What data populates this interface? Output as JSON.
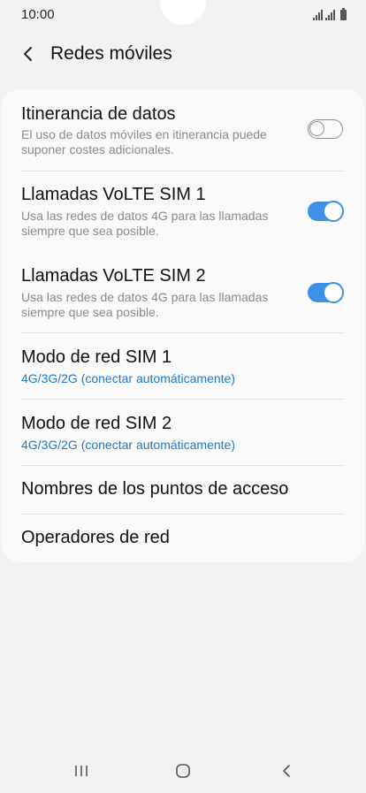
{
  "status_bar": {
    "time": "10:00",
    "icons": [
      "signal-sim1-icon",
      "signal-sim2-icon",
      "battery-icon"
    ]
  },
  "header": {
    "back_icon": "chevron-left-icon",
    "title": "Redes móviles"
  },
  "settings": {
    "data_roaming": {
      "title": "Itinerancia de datos",
      "description": "El uso de datos móviles en itinerancia puede suponer costes adicionales.",
      "enabled": false
    },
    "volte_sim1": {
      "title": "Llamadas VoLTE SIM 1",
      "description": "Usa las redes de datos 4G para las llamadas siempre que sea posible.",
      "enabled": true
    },
    "volte_sim2": {
      "title": "Llamadas VoLTE SIM 2",
      "description": "Usa las redes de datos 4G para las llamadas siempre que sea posible.",
      "enabled": true
    },
    "network_mode_sim1": {
      "title": "Modo de red SIM 1",
      "value": "4G/3G/2G (conectar automáticamente)"
    },
    "network_mode_sim2": {
      "title": "Modo de red SIM 2",
      "value": "4G/3G/2G (conectar automáticamente)"
    },
    "access_point_names": {
      "title": "Nombres de los puntos de acceso"
    },
    "network_operators": {
      "title": "Operadores de red"
    }
  },
  "nav_bar": {
    "icons": [
      "recent-apps-icon",
      "home-icon",
      "back-icon"
    ]
  },
  "colors": {
    "background": "#f2f2f2",
    "card": "#fafafa",
    "accent": "#3e91e8",
    "link_text": "#1f7ac9",
    "secondary_text": "#8a8a8a"
  }
}
